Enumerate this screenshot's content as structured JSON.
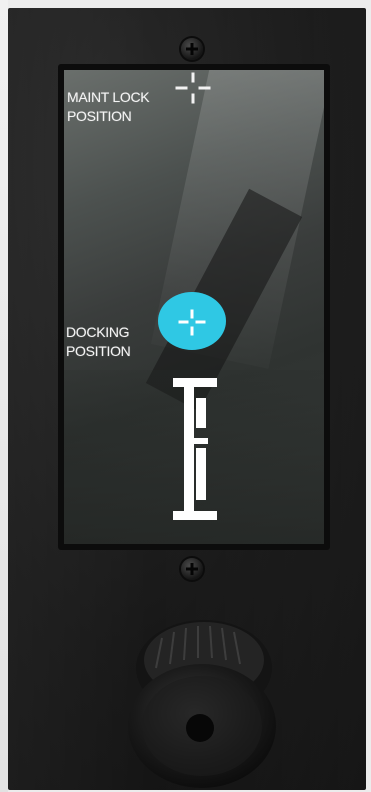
{
  "panel": {
    "maint_lock_label": [
      "MAINT LOCK",
      "POSITION"
    ],
    "docking_label": [
      "DOCKING",
      "POSITION"
    ],
    "indicator_color": "#2fc8e4",
    "label_color": "#f4f4f4"
  },
  "icons": {
    "top_screw": "screw-icon",
    "mid_screw": "screw-icon",
    "maint_crosshair": "crosshair-icon",
    "dock_crosshair": "crosshair-icon",
    "level_marker": "rail-marker-icon",
    "knob": "rotary-knob-icon"
  }
}
